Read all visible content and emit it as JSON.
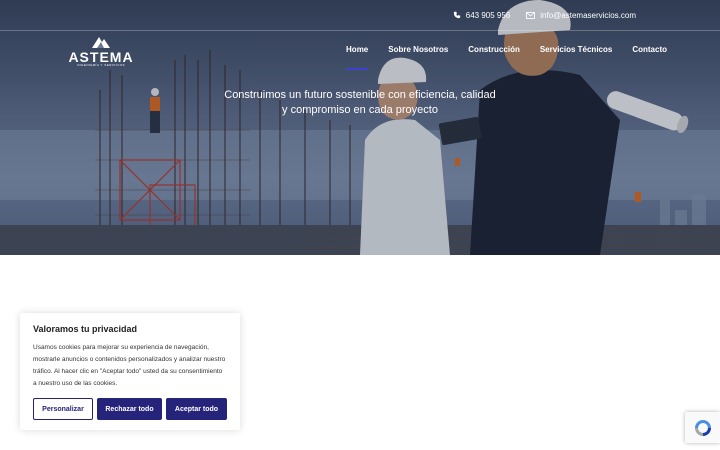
{
  "topbar": {
    "phone": "643 905 956",
    "email": "info@astemaservicios.com"
  },
  "logo": {
    "name": "ASTEMA",
    "subtitle": "INGENIERÍA Y SERVICIOS"
  },
  "nav": {
    "items": [
      {
        "label": "Home",
        "active": true
      },
      {
        "label": "Sobre Nosotros"
      },
      {
        "label": "Construcción"
      },
      {
        "label": "Servicios Técnicos"
      },
      {
        "label": "Contacto"
      }
    ]
  },
  "hero": {
    "tagline_line1": "Construimos un futuro sostenible con eficiencia, calidad",
    "tagline_line2": "y compromiso en cada proyecto"
  },
  "cookie": {
    "title": "Valoramos tu privacidad",
    "body": "Usamos cookies para mejorar su experiencia de navegación, mostrarle anuncios o contenidos personalizados y analizar nuestro tráfico. Al hacer clic en \"Aceptar todo\" usted da su consentimiento a nuestro uso de las cookies.",
    "customize": "Personalizar",
    "reject": "Rechazar todo",
    "accept": "Aceptar todo"
  },
  "colors": {
    "brand": "#26237a",
    "nav_active": "#3f3fd0"
  }
}
